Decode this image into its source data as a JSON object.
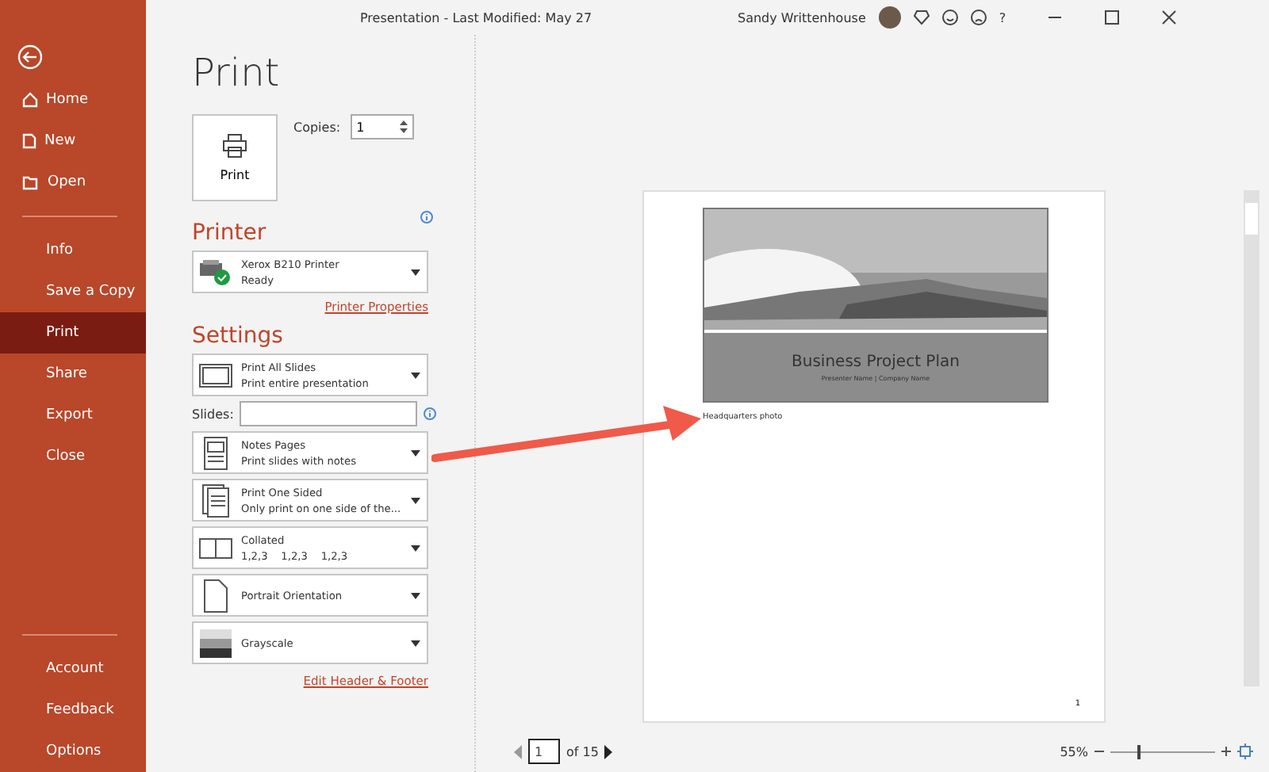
{
  "titlebar": {
    "title": "Presentation  -  Last Modified: May 27",
    "user_name": "Sandy Writtenhouse",
    "help": "?"
  },
  "sidebar": {
    "top": [
      {
        "label": "Home",
        "selected": false
      },
      {
        "label": "New",
        "selected": false
      },
      {
        "label": "Open",
        "selected": false
      }
    ],
    "middle": [
      {
        "label": "Info",
        "selected": false
      },
      {
        "label": "Save a Copy",
        "selected": false
      },
      {
        "label": "Print",
        "selected": true
      },
      {
        "label": "Share",
        "selected": false
      },
      {
        "label": "Export",
        "selected": false
      },
      {
        "label": "Close",
        "selected": false
      }
    ],
    "bottom": [
      {
        "label": "Account",
        "selected": false
      },
      {
        "label": "Feedback",
        "selected": false
      },
      {
        "label": "Options",
        "selected": false
      }
    ]
  },
  "print_panel": {
    "heading": "Print",
    "print_button": "Print",
    "copies": {
      "label": "Copies:",
      "value": "1"
    },
    "printer": {
      "heading": "Printer",
      "name": "Xerox B210 Printer",
      "status": "Ready",
      "properties_link": "Printer Properties"
    },
    "settings": {
      "heading": "Settings",
      "items": [
        {
          "kind": "dropdown",
          "title": "Print All Slides",
          "subtitle": "Print entire presentation"
        },
        {
          "kind": "field",
          "label": "Slides:"
        },
        {
          "kind": "dropdown",
          "title": "Notes Pages",
          "subtitle": "Print slides with notes"
        },
        {
          "kind": "dropdown",
          "title": "Print One Sided",
          "subtitle": "Only print on one side of the..."
        },
        {
          "kind": "dropdown",
          "title": "Collated",
          "subtitle": "1,2,3    1,2,3    1,2,3"
        },
        {
          "kind": "dropdown",
          "title": "Portrait Orientation"
        },
        {
          "kind": "dropdown",
          "title": "Grayscale"
        }
      ]
    },
    "edit_link": "Edit Header & Footer"
  },
  "preview": {
    "slide_title": "Business Project Plan",
    "slide_subtitle": "Presenter Name | Company Name",
    "note": "Headquarters photo",
    "page_number": "1"
  },
  "navigation": {
    "current_page": "1",
    "page_count": "of 15",
    "zoom": "55%",
    "zoom_slider": {
      "level": 0.26
    }
  }
}
